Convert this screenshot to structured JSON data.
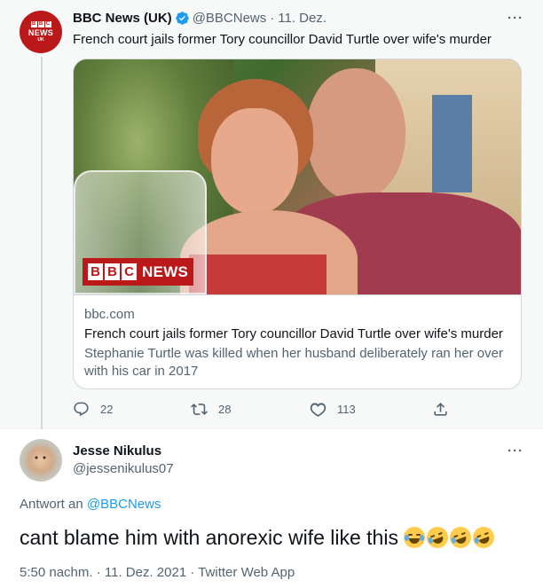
{
  "parent_tweet": {
    "avatar_name": "BBC News UK avatar",
    "avatar_lines": [
      "BBC",
      "NEWS",
      "UK"
    ],
    "display_name": "BBC News (UK)",
    "handle": "@BBCNews",
    "separator": "·",
    "date": "11. Dez.",
    "more_label": "···",
    "text": "French court jails former Tory councillor David Turtle over wife's murder",
    "card": {
      "image_logo_text": "NEWS",
      "logo_letters": [
        "B",
        "B",
        "C"
      ],
      "domain": "bbc.com",
      "title": "French court jails former Tory councillor David Turtle over wife's murder",
      "description_line1": "Stephanie Turtle was killed when her husband deliberately ran her over",
      "description_line2": "with his car in 2017"
    },
    "actions": {
      "reply_count": "22",
      "retweet_count": "28",
      "like_count": "113"
    }
  },
  "reply_tweet": {
    "display_name": "Jesse Nikulus",
    "handle": "@jessenikulus07",
    "more_label": "···",
    "replying_prefix": "Antwort an",
    "replying_to": "@BBCNews",
    "text": "cant blame him with anorexic wife like this ",
    "emoji_names": [
      "face-with-tears-of-joy",
      "rolling-on-the-floor-laughing",
      "rolling-on-the-floor-laughing",
      "rolling-on-the-floor-laughing"
    ],
    "meta": "5:50 nachm. · 11. Dez. 2021 · Twitter Web App"
  },
  "colors": {
    "accent": "#1d9bf0",
    "bbc_red": "#bb1919",
    "secondary_text": "#536471",
    "parent_background": "#f7f9f9"
  }
}
